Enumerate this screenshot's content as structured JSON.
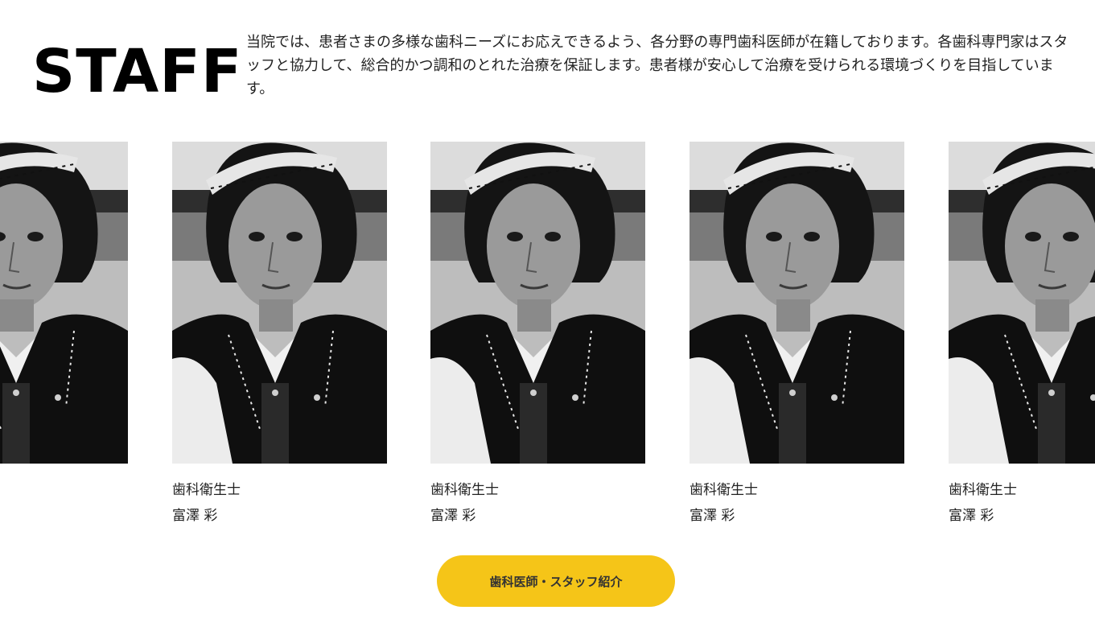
{
  "section": {
    "title": "STAFF",
    "intro": "当院では、患者さまの多様な歯科ニーズにお応えできるよう、各分野の専門歯科医師が在籍しております。各歯科専門家はスタッフと協力して、総合的かつ調和のとれた治療を保証します。患者様が安心して治療を受けられる環境づくりを目指しています。"
  },
  "staff": [
    {
      "role": "",
      "name": ""
    },
    {
      "role": "歯科衛生士",
      "name": "富澤 彩"
    },
    {
      "role": "歯科衛生士",
      "name": "富澤 彩"
    },
    {
      "role": "歯科衛生士",
      "name": "富澤 彩"
    },
    {
      "role": "歯科衛生士",
      "name": "富澤 彩"
    }
  ],
  "cta": {
    "label": "歯科医師・スタッフ紹介"
  },
  "colors": {
    "accent": "#f5c518",
    "text": "#1a1a1a",
    "background": "#ffffff"
  }
}
